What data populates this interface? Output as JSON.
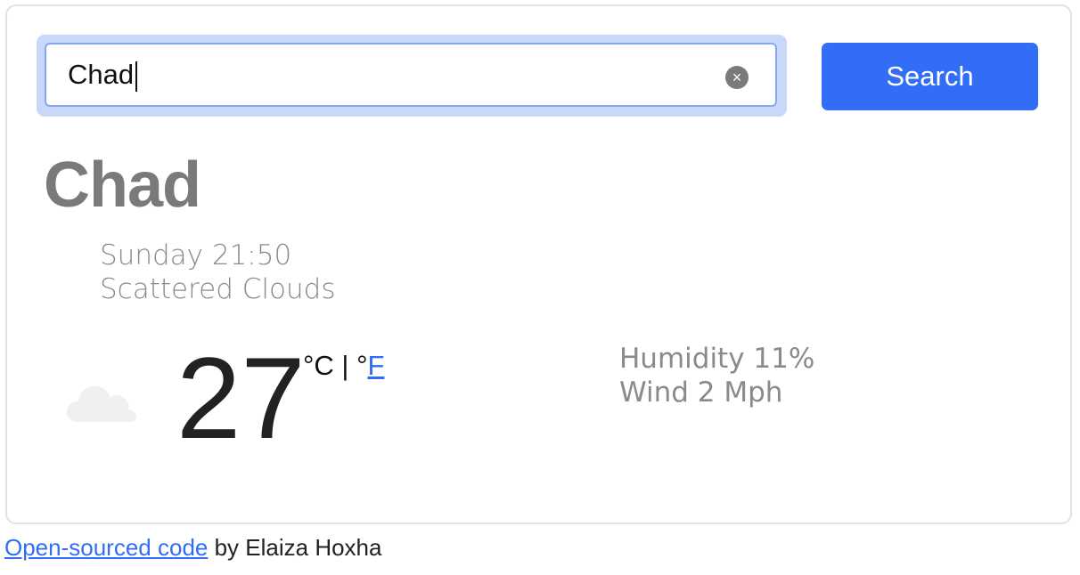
{
  "search": {
    "value": "Chad",
    "clear_icon": "×",
    "button_label": "Search"
  },
  "weather": {
    "city": "Chad",
    "datetime": "Sunday 21:50",
    "description": "Scattered Clouds",
    "icon": "cloud-icon",
    "temperature": "27",
    "unit_celsius": "°C",
    "unit_separator": " | ",
    "unit_f_prefix": "°",
    "unit_f_link": "F",
    "humidity": "Humidity 11%",
    "wind": "Wind 2 Mph"
  },
  "footer": {
    "link_text": "Open-sourced code",
    "suffix": " by Elaiza Hoxha"
  },
  "colors": {
    "accent": "#316ef5",
    "muted_text": "#8a8a8a",
    "city_text": "#7a7a7a"
  }
}
